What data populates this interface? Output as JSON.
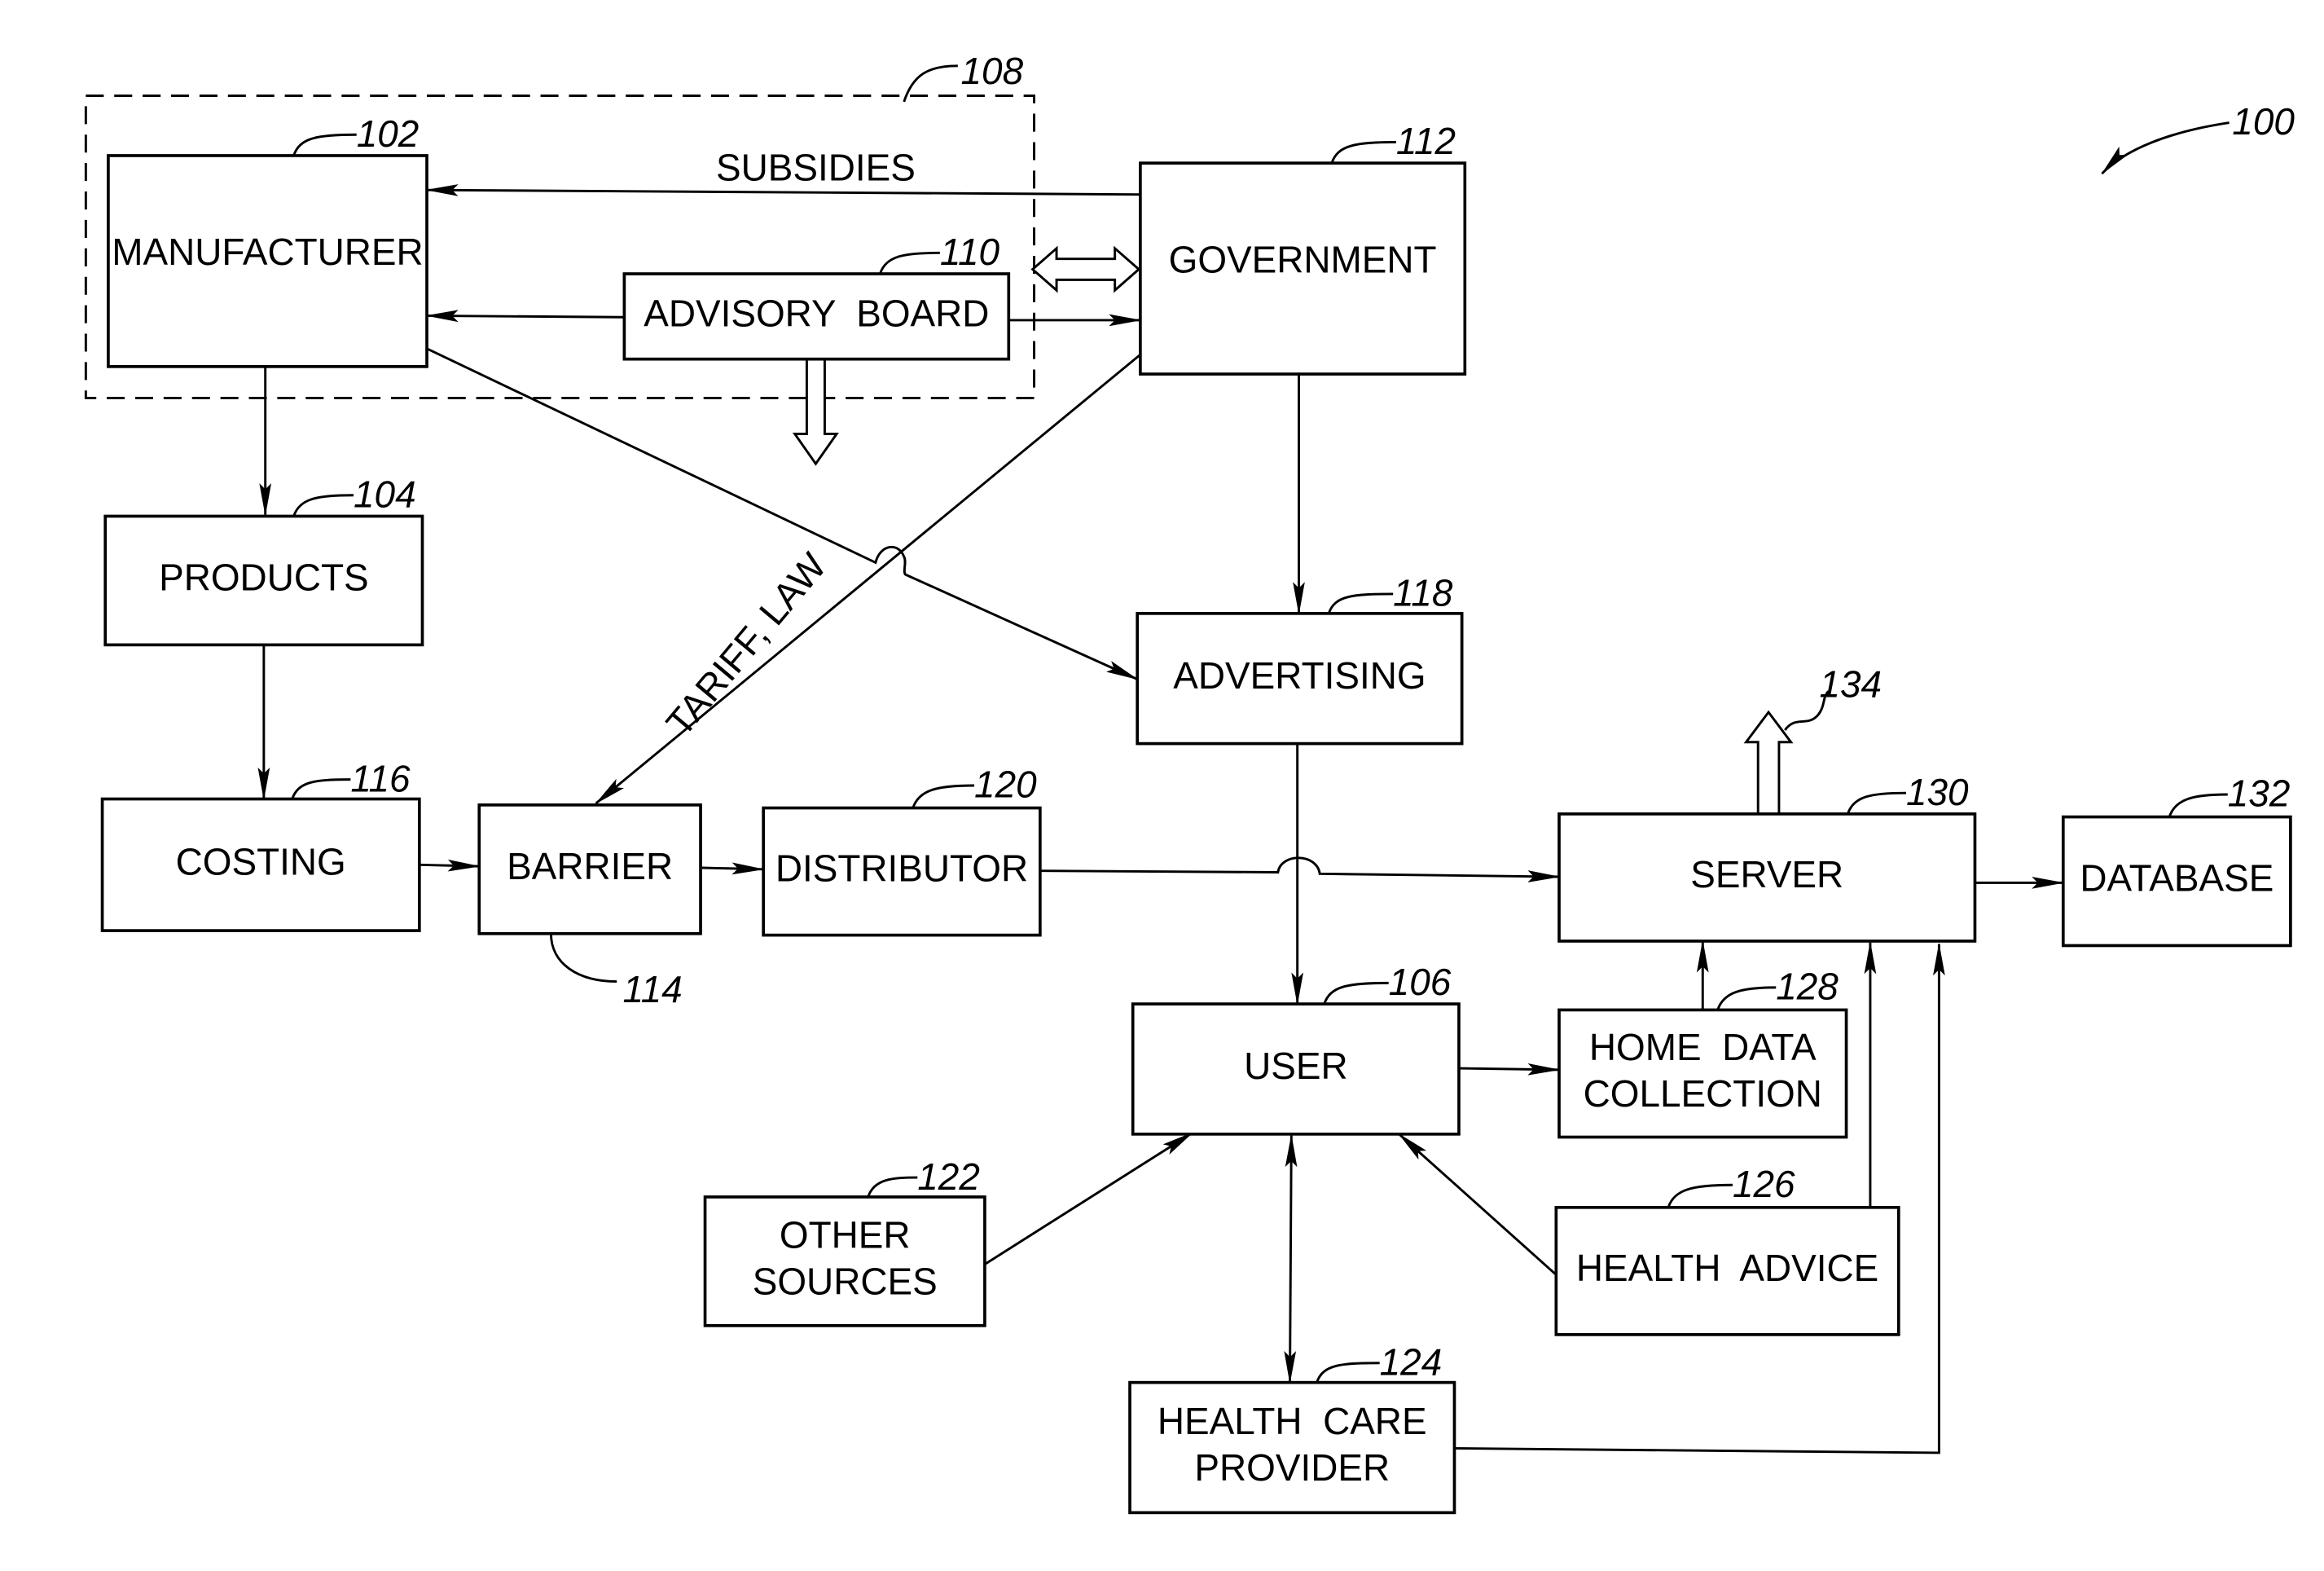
{
  "figure": {
    "ref": "100",
    "group_ref": "108"
  },
  "nodes": [
    {
      "id": "manufacturer",
      "ref": "102",
      "lines": [
        "MANUFACTURER"
      ]
    },
    {
      "id": "products",
      "ref": "104",
      "lines": [
        "PRODUCTS"
      ]
    },
    {
      "id": "user",
      "ref": "106",
      "lines": [
        "USER"
      ]
    },
    {
      "id": "advisory-board",
      "ref": "110",
      "lines": [
        "ADVISORY  BOARD"
      ]
    },
    {
      "id": "government",
      "ref": "112",
      "lines": [
        "GOVERNMENT"
      ]
    },
    {
      "id": "barrier",
      "ref": "114",
      "lines": [
        "BARRIER"
      ]
    },
    {
      "id": "costing",
      "ref": "116",
      "lines": [
        "COSTING"
      ]
    },
    {
      "id": "advertising",
      "ref": "118",
      "lines": [
        "ADVERTISING"
      ]
    },
    {
      "id": "distributor",
      "ref": "120",
      "lines": [
        "DISTRIBUTOR"
      ]
    },
    {
      "id": "other-sources",
      "ref": "122",
      "lines": [
        "OTHER",
        "SOURCES"
      ]
    },
    {
      "id": "health-care-provider",
      "ref": "124",
      "lines": [
        "HEALTH  CARE",
        "PROVIDER"
      ]
    },
    {
      "id": "health-advice",
      "ref": "126",
      "lines": [
        "HEALTH  ADVICE"
      ]
    },
    {
      "id": "home-data-collection",
      "ref": "128",
      "lines": [
        "HOME  DATA",
        "COLLECTION"
      ]
    },
    {
      "id": "server",
      "ref": "130",
      "lines": [
        "SERVER"
      ]
    },
    {
      "id": "database",
      "ref": "132",
      "lines": [
        "DATABASE"
      ]
    }
  ],
  "output_ref": "134",
  "edge_labels": {
    "subsidies": "SUBSIDIES",
    "tariff_law": "TARIFF,  LAW"
  },
  "edges": [
    {
      "from": "government",
      "to": "manufacturer",
      "label": "SUBSIDIES"
    },
    {
      "from": "advisory-board",
      "to": "manufacturer"
    },
    {
      "from": "advisory-board",
      "to": "government"
    },
    {
      "from": "advisory-board",
      "to": "government",
      "type": "bidirectional-hollow"
    },
    {
      "from": "manufacturer",
      "to": "products"
    },
    {
      "from": "manufacturer",
      "to": "advertising"
    },
    {
      "from": "government",
      "to": "barrier",
      "label": "TARIFF,  LAW"
    },
    {
      "from": "government",
      "to": "advertising"
    },
    {
      "from": "products",
      "to": "costing"
    },
    {
      "from": "costing",
      "to": "barrier"
    },
    {
      "from": "barrier",
      "to": "distributor"
    },
    {
      "from": "distributor",
      "to": "server"
    },
    {
      "from": "advertising",
      "to": "user"
    },
    {
      "from": "user",
      "to": "home-data-collection"
    },
    {
      "from": "home-data-collection",
      "to": "server"
    },
    {
      "from": "health-advice",
      "to": "server"
    },
    {
      "from": "health-care-provider",
      "to": "server"
    },
    {
      "from": "server",
      "to": "database"
    },
    {
      "from": "other-sources",
      "to": "user"
    },
    {
      "from": "health-advice",
      "to": "user"
    },
    {
      "from": "user",
      "to": "health-care-provider",
      "type": "bidirectional"
    }
  ]
}
